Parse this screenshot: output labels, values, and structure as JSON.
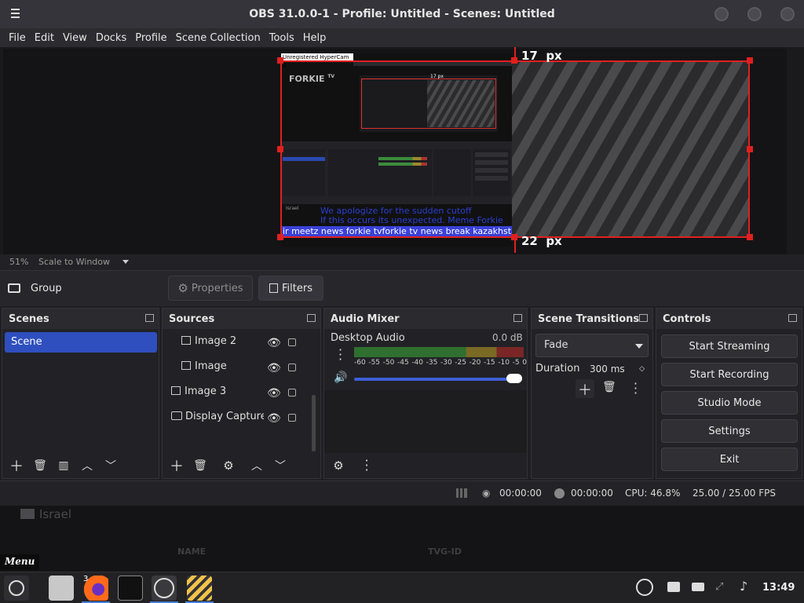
{
  "window": {
    "title": "OBS 31.0.0-1 - Profile: Untitled - Scenes: Untitled"
  },
  "menu": [
    "File",
    "Edit",
    "View",
    "Docks",
    "Profile",
    "Scene Collection",
    "Tools",
    "Help"
  ],
  "preview": {
    "inner_watermark": "Unregistered HyperCam 2",
    "inner_logo": "FORKIE",
    "inner_logo_sub": "TV",
    "offset_top": "17  px",
    "offset_bottom": "22  px",
    "inner_offset": "17 px",
    "scroll_text_1": "We apologize for the sudden cutoff",
    "scroll_text_2": "If this occurs its unexpected. Meme Forkie",
    "ticker": "ir meetz news forkie tvforkie tv news break kazakhstar th",
    "inner_flag": "Israel"
  },
  "zoom": {
    "percent": "51%",
    "mode": "Scale to Window"
  },
  "groupbar": {
    "label": "Group",
    "properties": "Properties",
    "filters": "Filters"
  },
  "scenes": {
    "title": "Scenes",
    "items": [
      "Scene"
    ]
  },
  "sources": {
    "title": "Sources",
    "items": [
      "Image 2",
      "Image",
      "Image 3",
      "Display Capture"
    ]
  },
  "mixer": {
    "title": "Audio Mixer",
    "channel": "Desktop Audio",
    "level": "0.0 dB",
    "ticks": [
      "-60",
      "-55",
      "-50",
      "-45",
      "-40",
      "-35",
      "-30",
      "-25",
      "-20",
      "-15",
      "-10",
      "-5",
      "0"
    ]
  },
  "transitions": {
    "title": "Scene Transitions",
    "selected": "Fade",
    "duration_label": "Duration",
    "duration_value": "300 ms"
  },
  "controls": {
    "title": "Controls",
    "buttons": [
      "Start Streaming",
      "Start Recording",
      "Studio Mode",
      "Settings",
      "Exit"
    ]
  },
  "status": {
    "stream_time": "00:00:00",
    "rec_time": "00:00:00",
    "cpu": "CPU: 46.8%",
    "fps": "25.00 / 25.00 FPS"
  },
  "desktop": {
    "flag": "Israel",
    "col_name": "NAME",
    "col_tvg": "TVG-ID",
    "menu_label": "Menu"
  },
  "taskbar": {
    "clock": "13:49",
    "badge": "3"
  }
}
